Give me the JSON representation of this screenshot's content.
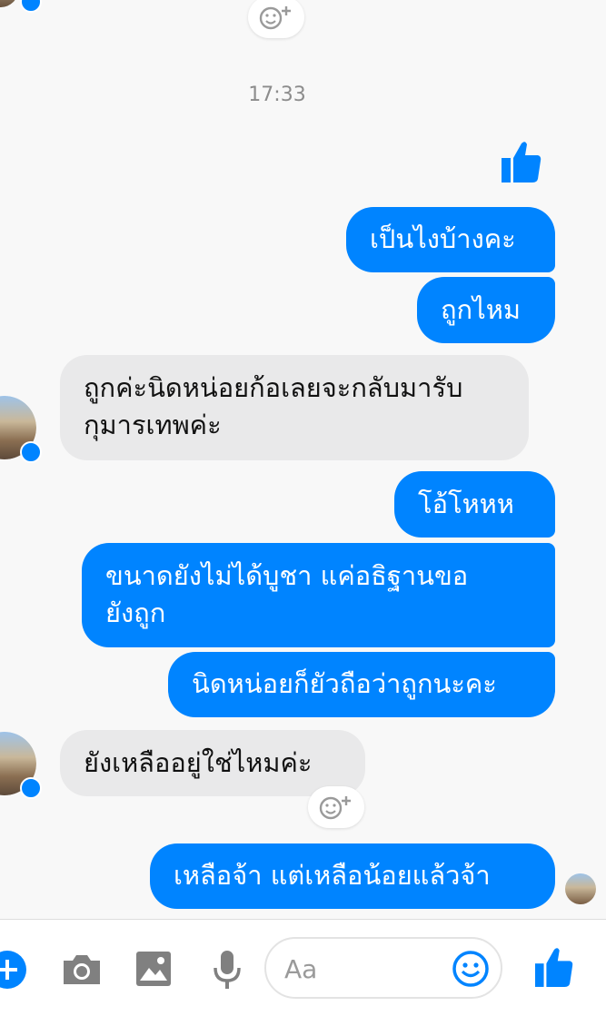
{
  "conversation": {
    "timestamp": "17:33",
    "messages": [
      {
        "id": 1,
        "side": "out",
        "text": "เป็นไงบ้างคะ"
      },
      {
        "id": 2,
        "side": "out",
        "text": "ถูกไหม"
      },
      {
        "id": 3,
        "side": "in",
        "text": "ถูกค่ะนิดหน่อยก้อเลยจะกลับมารับ\nกุมารเทพค่ะ"
      },
      {
        "id": 4,
        "side": "out",
        "text": "โอ้โหหห"
      },
      {
        "id": 5,
        "side": "out",
        "text": "ขนาดยังไม่ได้บูชา แค่อธิฐานขอ\nยังถูก"
      },
      {
        "id": 6,
        "side": "out",
        "text": "นิดหน่อยก็ยัวถือว่าถูกนะคะ"
      },
      {
        "id": 7,
        "side": "in",
        "text": "ยังเหลืออยู่ใช่ไหมค่ะ"
      },
      {
        "id": 8,
        "side": "out",
        "text": "เหลือจ้า  แต่เหลือน้อยแล้วจ้า"
      }
    ]
  },
  "composer": {
    "placeholder": "Aa"
  },
  "icons": {
    "add": "plus-circle-icon",
    "camera": "camera-icon",
    "gallery": "image-icon",
    "mic": "microphone-icon",
    "emoji": "smiley-icon",
    "like": "thumbs-up-icon",
    "reaction": "add-reaction-icon"
  },
  "colors": {
    "accent": "#0084ff",
    "incoming_bubble": "#e9e9ea",
    "background": "#f8f8f8"
  }
}
